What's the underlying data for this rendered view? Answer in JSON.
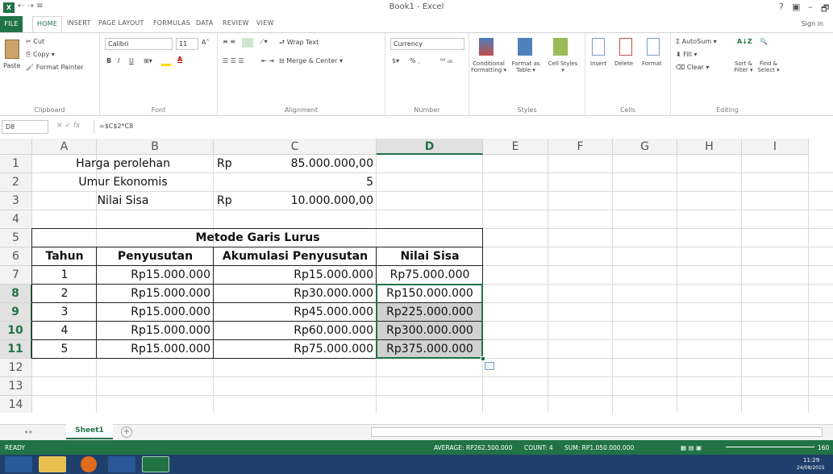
{
  "window": {
    "title": "Book1 - Excel",
    "quick_access": "⇠ ⇢ ≡",
    "controls": [
      "?",
      "▣",
      "–",
      "🗗"
    ]
  },
  "tabs": [
    "FILE",
    "HOME",
    "INSERT",
    "PAGE LAYOUT",
    "FORMULAS",
    "DATA",
    "REVIEW",
    "VIEW"
  ],
  "signin": "Sign in",
  "ribbon": {
    "clipboard": {
      "paste": "Paste",
      "cut": "Cut",
      "copy": "Copy ▾",
      "painter": "Format Painter",
      "label": "Clipboard"
    },
    "font": {
      "name": "Calibri",
      "size": "11",
      "label": "Font",
      "bold": "B",
      "italic": "I",
      "underline": "U"
    },
    "alignment": {
      "wrap": "Wrap Text",
      "merge": "Merge & Center ▾",
      "label": "Alignment"
    },
    "number": {
      "format": "Currency",
      "percent": "% ,",
      "label": "Number"
    },
    "styles": {
      "cond": "Conditional Formatting ▾",
      "table": "Format as Table ▾",
      "cell": "Cell Styles ▾",
      "label": "Styles"
    },
    "cells": {
      "insert": "Insert",
      "delete": "Delete",
      "format": "Format",
      "label": "Cells"
    },
    "editing": {
      "autosum": "AutoSum ▾",
      "fill": "Fill ▾",
      "clear": "Clear ▾",
      "sort": "Sort & Filter ▾",
      "find": "Find & Select ▾",
      "label": "Editing"
    }
  },
  "formula_bar": {
    "name_box": "D8",
    "fx": "fx",
    "formula": "=$C$2*C8"
  },
  "columns": [
    "A",
    "B",
    "C",
    "D",
    "E",
    "F",
    "G",
    "H",
    "I"
  ],
  "rows": [
    "1",
    "2",
    "3",
    "4",
    "5",
    "6",
    "7",
    "8",
    "9",
    "10",
    "11",
    "12",
    "13",
    "14"
  ],
  "info": {
    "harga_label": "Harga perolehan",
    "harga_rp": "Rp",
    "harga_val": "85.000.000,00",
    "umur_label": "Umur Ekonomis",
    "umur_val": "5",
    "sisa_label": "Nilai Sisa",
    "sisa_rp": "Rp",
    "sisa_val": "10.000.000,00"
  },
  "table": {
    "title": "Metode Garis Lurus",
    "headers": [
      "Tahun",
      "Penyusutan",
      "Akumulasi Penyusutan",
      "Nilai Sisa"
    ],
    "rows": [
      [
        "1",
        "Rp15.000.000",
        "Rp15.000.000",
        "Rp75.000.000"
      ],
      [
        "2",
        "Rp15.000.000",
        "Rp30.000.000",
        "Rp150.000.000"
      ],
      [
        "3",
        "Rp15.000.000",
        "Rp45.000.000",
        "Rp225.000.000"
      ],
      [
        "4",
        "Rp15.000.000",
        "Rp60.000.000",
        "Rp300.000.000"
      ],
      [
        "5",
        "Rp15.000.000",
        "Rp75.000.000",
        "Rp375.000.000"
      ]
    ]
  },
  "sheet": {
    "name": "Sheet1",
    "add": "+"
  },
  "status": {
    "mode": "READY",
    "average": "AVERAGE: RP262.500.000",
    "count": "COUNT: 4",
    "sum": "SUM: RP1.050.000.000",
    "zoom": "160"
  },
  "clock": {
    "time": "11:29",
    "date": "24/08/2015"
  },
  "colors": {
    "excel_green": "#217346",
    "selection_fill": "#d0d0d0",
    "taskbar": "#1f3f6c"
  }
}
